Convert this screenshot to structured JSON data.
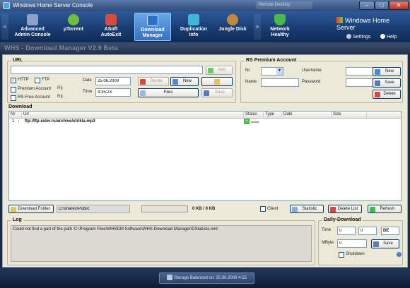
{
  "window": {
    "title": "Windows Home Server Console",
    "ghost_tab": "Remote Desktop",
    "min_label": "–",
    "max_label": "□",
    "close_label": "✕"
  },
  "nav": {
    "items": [
      {
        "label": "Advanced",
        "sub": "Admin Console",
        "icon": "admin-console-icon",
        "color": "#8aa2c8"
      },
      {
        "label": "µTorrent",
        "sub": "",
        "icon": "utorrent-icon",
        "color": "#6fbf3a"
      },
      {
        "label": "ASoft",
        "sub": "AutoExit",
        "icon": "autoexit-icon",
        "color": "#d84a3a"
      },
      {
        "label": "Download",
        "sub": "Manager",
        "icon": "download-manager-icon",
        "color": "#2a6fc8"
      },
      {
        "label": "Duplication",
        "sub": "Info",
        "icon": "duplication-info-icon",
        "color": "#3fb8d8"
      },
      {
        "label": "Jungle Disk",
        "sub": "",
        "icon": "jungle-disk-icon",
        "color": "#c08a3a"
      },
      {
        "label": "Network",
        "sub": "Healthy",
        "icon": "network-shield-icon",
        "color": "#4ab84a"
      }
    ],
    "brand": "Windows Home Server",
    "settings": "Settings",
    "help": "Help"
  },
  "app": {
    "header": "WHS - Download Manager V2.9 Beta"
  },
  "url_group": {
    "title": "URL",
    "url_value": "",
    "add_label": "Add",
    "http_label": "HTTP",
    "ftp_label": "FTP",
    "http_checked": "✓",
    "premium_label": "Premium Account",
    "rsfree_label": "RS-Free Account",
    "rs_badge": "R§",
    "date_label": "Date",
    "date_value": "25.06.2009",
    "time_label": "Time",
    "time_value": "4:35:23",
    "delete_label": "Delete",
    "new_label": "New",
    "files_label": "Files",
    "save_label": "Save"
  },
  "rs_group": {
    "title": "RS Premium Account",
    "nr_label": "Nr.",
    "username_label": "Username",
    "name_label": "Name",
    "password_label": "Password",
    "new_label": "New",
    "save_label": "Save",
    "delete_label": "Delete"
  },
  "download_group": {
    "title": "Download",
    "columns": [
      "Nr",
      "Url",
      "Status",
      "Type",
      "Date",
      "Size"
    ],
    "rows": [
      {
        "nr": "1",
        "flag": "↓",
        "url": "ftp://ftp.exler.ru/archive/strikia.mp3",
        "status": "added",
        "type": "",
        "date": "",
        "size": ""
      }
    ]
  },
  "toolbar": {
    "download_folder_label": "Download Folder",
    "folder_path": "D:\\shares\\Public",
    "speed_text": "0 KB / 0 KB",
    "client_label": "Client",
    "statistic_label": "Statistic",
    "delete_list_label": "Delete List",
    "refresh_label": "Refresh"
  },
  "log_group": {
    "title": "Log",
    "message": "Could not find a part of the path 'C:\\Program Files\\WHSDM Software\\WHS Download Manager\\DStatistic.xml'."
  },
  "daily_group": {
    "title": "Daily-Download",
    "time_label": "Time",
    "time_h": "0",
    "time_m": "0",
    "lang_value": "DE",
    "mbyte_label": "MByte",
    "mbyte_value": "0",
    "save_label": "Save",
    "shutdown_label": "Shutdown"
  },
  "status": {
    "text": "Storage Balanced on: 25.06.2009 4:15"
  }
}
